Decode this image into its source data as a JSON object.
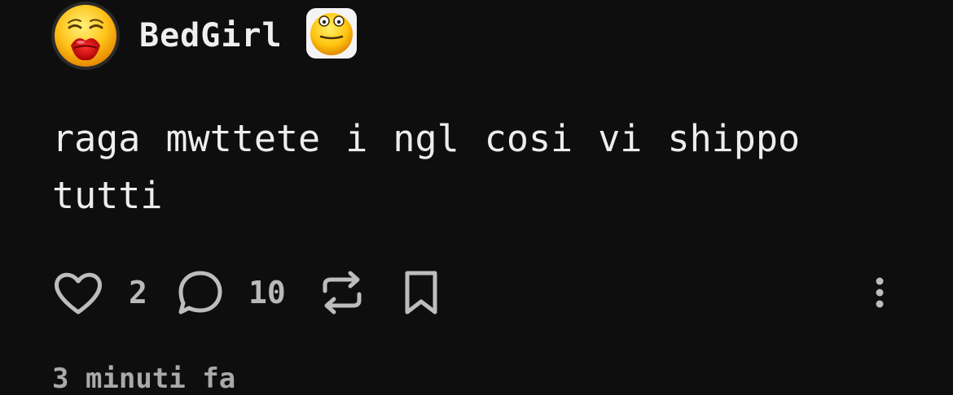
{
  "post": {
    "author": {
      "username": "BedGirl",
      "avatar_icon": "kissing-face-avatar",
      "badge_icon": "dizzy-face-emoji"
    },
    "text": "raga mwttete i ngl cosi vi shippo tutti",
    "actions": {
      "like_icon": "heart-icon",
      "like_count": "2",
      "comment_icon": "comment-bubble-icon",
      "comment_count": "10",
      "repost_icon": "repost-icon",
      "bookmark_icon": "bookmark-icon",
      "more_icon": "more-vertical-icon"
    },
    "timestamp": "3 minuti fa"
  },
  "colors": {
    "background": "#0e0e0e",
    "text": "#ececec",
    "muted": "#b9b9b9"
  }
}
